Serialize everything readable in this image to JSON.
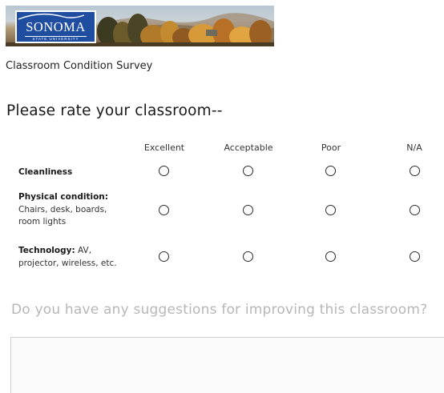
{
  "banner": {
    "logo_word": "SONOMA",
    "logo_sub": "STATE UNIVERSITY",
    "logo_color": "#1f4ea1"
  },
  "survey": {
    "title": "Classroom Condition Survey"
  },
  "question1": {
    "title": "Please rate your classroom--",
    "columns": [
      "Excellent",
      "Acceptable",
      "Poor",
      "N/A"
    ],
    "rows": [
      {
        "bold": "Cleanliness",
        "rest": ""
      },
      {
        "bold": "Physical condition:",
        "rest": "Chairs, desk, boards, room lights"
      },
      {
        "bold": "Technology:",
        "rest": " AV, projector, wireless, etc."
      }
    ],
    "selected": [
      null,
      null,
      null
    ]
  },
  "question2": {
    "title": "Do you have any suggestions for improving this classroom?",
    "value": "",
    "placeholder": ""
  }
}
